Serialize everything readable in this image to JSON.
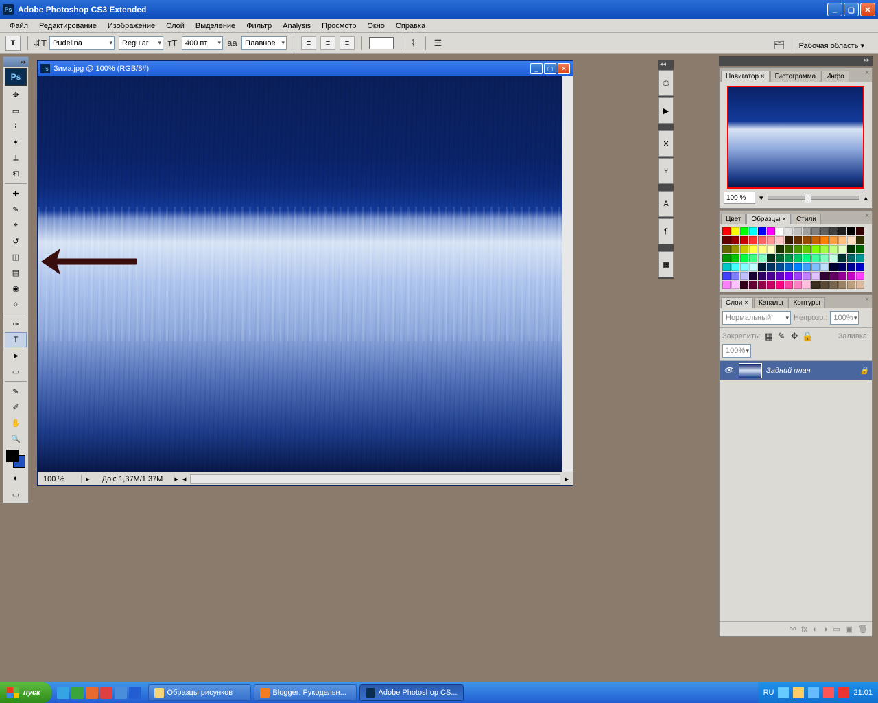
{
  "app": {
    "title": "Adobe Photoshop CS3 Extended"
  },
  "menu": [
    "Файл",
    "Редактирование",
    "Изображение",
    "Слой",
    "Выделение",
    "Фильтр",
    "Analysis",
    "Просмотр",
    "Окно",
    "Справка"
  ],
  "options": {
    "tool_glyph": "T",
    "orientation_glyph": "⇵T",
    "font_family": "Pudelina",
    "font_style": "Regular",
    "size_label": "тT",
    "size_value": "400 пт",
    "aa_prefix": "aa",
    "aa_value": "Плавное",
    "workspace_label": "Рабочая область ▾"
  },
  "document": {
    "title": "Зима.jpg @ 100% (RGB/8#)",
    "zoom": "100 %",
    "doc_info": "Док: 1,37M/1,37M"
  },
  "navigator": {
    "tabs": [
      "Навигатор",
      "Гистограмма",
      "Инфо"
    ],
    "active_tab": 0,
    "zoom": "100 %"
  },
  "swatches": {
    "tabs": [
      "Цвет",
      "Образцы",
      "Стили"
    ],
    "active_tab": 1,
    "colors": [
      "#ff0000",
      "#ffff00",
      "#00ff00",
      "#00ffff",
      "#0000ff",
      "#ff00ff",
      "#ffffff",
      "#e0e0e0",
      "#c0c0c0",
      "#a0a0a0",
      "#808080",
      "#606060",
      "#404040",
      "#202020",
      "#000000",
      "#320000",
      "#640000",
      "#960000",
      "#c80000",
      "#ff3232",
      "#ff6464",
      "#ff9696",
      "#ffc8c8",
      "#321900",
      "#643200",
      "#964b00",
      "#c86400",
      "#ff8000",
      "#ffa040",
      "#ffc080",
      "#ffe0c0",
      "#323200",
      "#646400",
      "#969600",
      "#c8c800",
      "#ffff40",
      "#ffff80",
      "#ffffc0",
      "#193200",
      "#326400",
      "#4b9600",
      "#64c800",
      "#80ff00",
      "#a0ff40",
      "#c0ff80",
      "#e0ffc0",
      "#003200",
      "#006400",
      "#009600",
      "#00c800",
      "#00ff40",
      "#40ff80",
      "#80ffc0",
      "#003219",
      "#006432",
      "#00964b",
      "#00c864",
      "#00ff80",
      "#40ffa0",
      "#80ffc0",
      "#c0ffe0",
      "#003232",
      "#006464",
      "#009696",
      "#00c8c8",
      "#40ffff",
      "#80ffff",
      "#c0ffff",
      "#001932",
      "#003264",
      "#004b96",
      "#0064c8",
      "#0080ff",
      "#40a0ff",
      "#80c0ff",
      "#c0e0ff",
      "#000032",
      "#000064",
      "#000096",
      "#0000c8",
      "#4040ff",
      "#8080ff",
      "#c0c0ff",
      "#190032",
      "#320064",
      "#4b0096",
      "#6400c8",
      "#8000ff",
      "#a040ff",
      "#c080ff",
      "#e0c0ff",
      "#320032",
      "#640064",
      "#960096",
      "#c800c8",
      "#ff40ff",
      "#ff80ff",
      "#ffc0ff",
      "#320019",
      "#640032",
      "#96004b",
      "#c80064",
      "#ff0080",
      "#ff40a0",
      "#ff80c0",
      "#ffc0e0",
      "#3a2e1e",
      "#5a4a36",
      "#7a664e",
      "#9a8266",
      "#ba9e7e",
      "#dabaa0"
    ]
  },
  "layers": {
    "tabs": [
      "Слои",
      "Каналы",
      "Контуры"
    ],
    "active_tab": 0,
    "blend_mode": "Нормальный",
    "opacity_label": "Непрозр.:",
    "opacity_value": "100%",
    "lock_label": "Закрепить:",
    "fill_label": "Заливка:",
    "fill_value": "100%",
    "items": [
      {
        "name": "Задний план",
        "locked": true
      }
    ]
  },
  "taskbar": {
    "start": "пуск",
    "tasks": [
      {
        "label": "Образцы рисунков",
        "icon_color": "#f5d47a"
      },
      {
        "label": "Blogger: Рукодельн...",
        "icon_color": "#f57c20"
      },
      {
        "label": "Adobe Photoshop CS...",
        "icon_color": "#0a2d52",
        "active": true
      }
    ],
    "lang": "RU",
    "time": "21:01"
  },
  "tools": [
    "move",
    "marquee",
    "lasso",
    "wand",
    "crop",
    "slice",
    "divider",
    "healing",
    "brush",
    "stamp",
    "history-brush",
    "eraser",
    "gradient",
    "blur",
    "dodge",
    "divider",
    "pen",
    "type",
    "path-select",
    "shape",
    "divider",
    "notes",
    "eyedropper",
    "hand",
    "zoom"
  ],
  "tool_glyphs": {
    "move": "✥",
    "marquee": "▭",
    "lasso": "⌇",
    "wand": "✶",
    "crop": "⟂",
    "slice": "⎗",
    "healing": "✚",
    "brush": "✎",
    "stamp": "⌖",
    "history-brush": "↺",
    "eraser": "◫",
    "gradient": "▤",
    "blur": "◉",
    "dodge": "☼",
    "pen": "✑",
    "type": "T",
    "path-select": "➤",
    "shape": "▭",
    "notes": "✎",
    "eyedropper": "✐",
    "hand": "✋",
    "zoom": "🔍"
  }
}
